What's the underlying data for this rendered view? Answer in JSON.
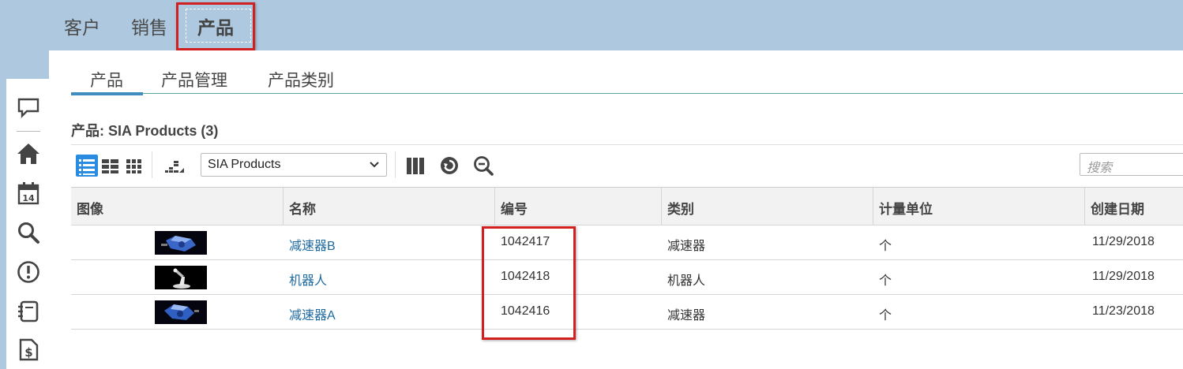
{
  "topnav": {
    "tabs": [
      {
        "label": "客户"
      },
      {
        "label": "销售"
      },
      {
        "label": "产品"
      }
    ]
  },
  "subnav": {
    "tabs": [
      {
        "label": "产品"
      },
      {
        "label": "产品管理"
      },
      {
        "label": "产品类别"
      }
    ]
  },
  "page": {
    "title": "产品: SIA Products (3)"
  },
  "toolbar": {
    "view_select_value": "SIA Products",
    "search_placeholder": "搜索"
  },
  "grid": {
    "columns": [
      "图像",
      "名称",
      "编号",
      "类别",
      "计量单位",
      "创建日期"
    ],
    "rows": [
      {
        "name": "减速器B",
        "number": "1042417",
        "category": "减速器",
        "unit": "个",
        "created": "11/29/2018"
      },
      {
        "name": "机器人",
        "number": "1042418",
        "category": "机器人",
        "unit": "个",
        "created": "11/29/2018"
      },
      {
        "name": "减速器A",
        "number": "1042416",
        "category": "减速器",
        "unit": "个",
        "created": "11/23/2018"
      }
    ]
  },
  "colors": {
    "header_bg": "#adc8df",
    "highlight": "#d21f1f",
    "link": "#1e6aa0",
    "active_view": "#2a8ce0"
  }
}
